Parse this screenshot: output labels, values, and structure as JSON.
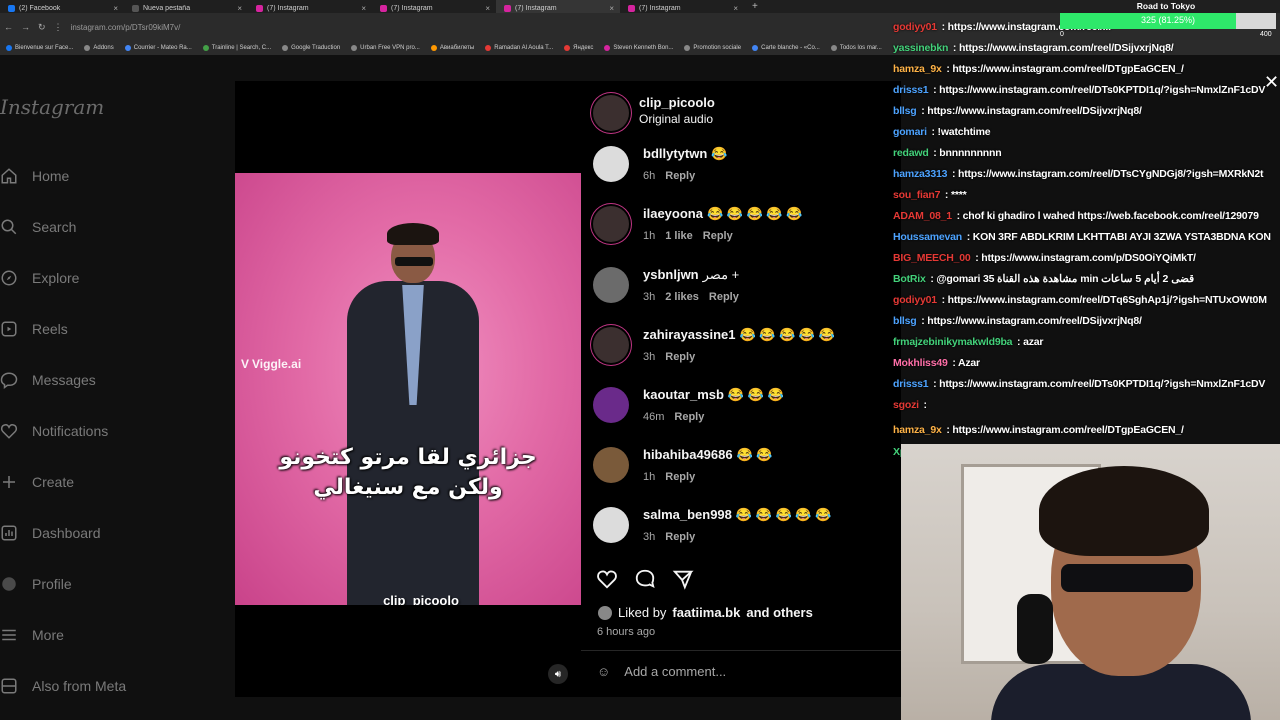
{
  "browser": {
    "tabs": [
      {
        "title": "(2) Facebook",
        "icon": "facebook-icon"
      },
      {
        "title": "Nueva pestaña",
        "icon": "blank-page-icon"
      },
      {
        "title": "(7) Instagram",
        "icon": "instagram-icon"
      },
      {
        "title": "(7) Instagram",
        "icon": "instagram-icon"
      },
      {
        "title": "(7) Instagram",
        "icon": "instagram-icon",
        "active": true
      },
      {
        "title": "(7) Instagram",
        "icon": "instagram-icon"
      }
    ],
    "url": "instagram.com/p/DTsr09kiM7v/",
    "bookmarks": [
      "Bienvenue sur Face...",
      "Addons",
      "Courrier - Mateo Ra...",
      "Trainline | Search, C...",
      "Google Traduction",
      "Urban Free VPN pro...",
      "Авиабилеты",
      "Ramadan Al Aoula T...",
      "Яндекс",
      "Steven Kenneth Bon...",
      "Promotion sociale",
      "Carte blanche - «Co...",
      "Todos los mar..."
    ]
  },
  "instagram": {
    "logo": "Instagram",
    "nav": [
      "Home",
      "Search",
      "Explore",
      "Reels",
      "Messages",
      "Notifications",
      "Create",
      "Dashboard",
      "Profile",
      "More",
      "Also from Meta"
    ]
  },
  "post": {
    "author": "clip_picoolo",
    "audio": "Original audio",
    "watermark": "Viggle.ai",
    "caption_line1": "جزائري لقا مرتو كتخونو",
    "caption_line2": "ولكن مع سنيغالي",
    "video_tag": "clip_picoolo",
    "comments": [
      {
        "user": "bdllytytwn",
        "text": "😂",
        "time": "6h",
        "likes": "",
        "reply": "Reply",
        "avatar": "grey"
      },
      {
        "user": "ilaeyoona",
        "text": "😂 😂 😂 😂 😂",
        "time": "1h",
        "likes": "1 like",
        "reply": "Reply",
        "avatar": "ring"
      },
      {
        "user": "ysbnljwn",
        "text": "مصر +",
        "time": "3h",
        "likes": "2 likes",
        "reply": "Reply",
        "avatar": "dark"
      },
      {
        "user": "zahirayassine1",
        "text": "😂 😂 😂 😂 😂",
        "time": "3h",
        "likes": "",
        "reply": "Reply",
        "avatar": "ring"
      },
      {
        "user": "kaoutar_msb",
        "text": "😂 😂 😂",
        "time": "46m",
        "likes": "",
        "reply": "Reply",
        "avatar": "purple"
      },
      {
        "user": "hibahiba49686",
        "text": "😂 😂",
        "time": "1h",
        "likes": "",
        "reply": "Reply",
        "avatar": "brown"
      },
      {
        "user": "salma_ben998",
        "text": "😂 😂 😂 😂 😂",
        "time": "3h",
        "likes": "",
        "reply": "Reply",
        "avatar": "grey"
      }
    ],
    "liked_prefix": "Liked by",
    "liked_user": "faatiima.bk",
    "liked_suffix": "and others",
    "ago": "6 hours ago",
    "add_comment_placeholder": "Add a comment..."
  },
  "stream": {
    "goal_title": "Road to Tokyo",
    "goal_label": "325 (81.25%)",
    "goal_fraction": 0.8125,
    "goal_min": "0",
    "goal_max": "400",
    "colors": {
      "goal_fill": "#2ee86a",
      "chat_name_red": "#e53935",
      "chat_name_blue": "#4da3ff",
      "chat_name_green": "#43d17a",
      "chat_name_orange": "#ffb347",
      "chat_name_pink": "#ff6fa8"
    },
    "chat": [
      {
        "user": "godiyy01",
        "msg": "https://www.instagram.com/reel/...",
        "color": "#e53935"
      },
      {
        "user": "yassinebkn",
        "msg": "https://www.instagram.com/reel/DSijvxrjNq8/",
        "color": "#43d17a"
      },
      {
        "user": "hamza_9x",
        "msg": "https://www.instagram.com/reel/DTgpEaGCEN_/",
        "color": "#ffb347"
      },
      {
        "user": "drisss1",
        "msg": "https://www.instagram.com/reel/DTs0KPTDI1q/?igsh=NmxlZnF1cDV",
        "color": "#4da3ff"
      },
      {
        "user": "bllsg",
        "msg": "https://www.instagram.com/reel/DSijvxrjNq8/",
        "color": "#4da3ff"
      },
      {
        "user": "gomari",
        "msg": "!watchtime",
        "color": "#4da3ff"
      },
      {
        "user": "redawd",
        "msg": "bnnnnnnnnn",
        "color": "#43d17a"
      },
      {
        "user": "hamza3313",
        "msg": "https://www.instagram.com/reel/DTsCYgNDGj8/?igsh=MXRkN2t",
        "color": "#4da3ff"
      },
      {
        "user": "sou_fian7",
        "msg": "****",
        "color": "#e53935"
      },
      {
        "user": "ADAM_08_1",
        "msg": "chof ki ghadiro l wahed https://web.facebook.com/reel/129079",
        "color": "#e53935"
      },
      {
        "user": "Houssamevan",
        "msg": "KON 3RF ABDLKRIM LKHTTABI AYJI 3ZWA YSTA3BDNA KON",
        "color": "#4da3ff"
      },
      {
        "user": "BIG_MEECH_00",
        "msg": "https://www.instagram.com/p/DS0OiYQiMkT/",
        "color": "#e53935"
      },
      {
        "user": "BotRix",
        "msg": "@gomari 35 مشاهدة هذه القناة min قضى 2 أيام 5 ساعات",
        "color": "#43d17a"
      },
      {
        "user": "godiyy01",
        "msg": "https://www.instagram.com/reel/DTq6SghAp1j/?igsh=NTUxOWt0M",
        "color": "#e53935"
      },
      {
        "user": "bllsg",
        "msg": "https://www.instagram.com/reel/DSijvxrjNq8/",
        "color": "#4da3ff"
      },
      {
        "user": "frmajzebinikymakwld9ba",
        "msg": "azar",
        "color": "#43d17a"
      },
      {
        "user": "Mokhliss49",
        "msg": "Azar",
        "color": "#ff6fa8"
      },
      {
        "user": "drisss1",
        "msg": "https://www.instagram.com/reel/DTs0KPTDI1q/?igsh=NmxlZnF1cDV",
        "color": "#4da3ff"
      },
      {
        "user": "sgozi",
        "msg": "",
        "color": "#e53935"
      },
      {
        "user": "hamza_9x",
        "msg": "https://www.instagram.com/reel/DTgpEaGCEN_/",
        "color": "#ffb347"
      },
      {
        "user": "Xpiba",
        "msg": "👑 👑 👑 👑 👑 💋 💋 💋 💋 💋 👑 👑 👑 👑 👑 💋 💋 💋 💋 💋 👑 👑 👑 👑",
        "color": "#43d17a"
      }
    ]
  }
}
